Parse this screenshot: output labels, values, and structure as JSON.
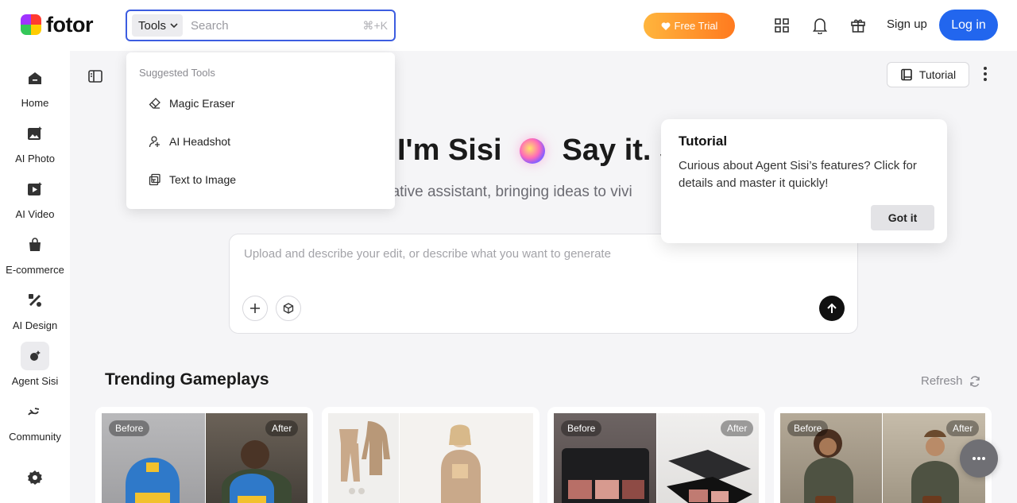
{
  "brand": {
    "name": "fotor"
  },
  "search": {
    "scope_label": "Tools",
    "placeholder": "Search",
    "shortcut": "⌘+K"
  },
  "header": {
    "free_trial": "Free Trial",
    "sign_up": "Sign up",
    "log_in": "Log in"
  },
  "sidebar": {
    "items": [
      {
        "label": "Home",
        "icon": "home-icon"
      },
      {
        "label": "AI Photo",
        "icon": "ai-photo-icon"
      },
      {
        "label": "AI Video",
        "icon": "ai-video-icon"
      },
      {
        "label": "E-commerce",
        "icon": "shopping-bag-icon"
      },
      {
        "label": "AI Design",
        "icon": "ai-design-icon"
      },
      {
        "label": "Agent Sisi",
        "icon": "agent-sisi-icon",
        "active": true
      },
      {
        "label": "Community",
        "icon": "community-icon"
      }
    ]
  },
  "dropdown": {
    "heading": "Suggested Tools",
    "items": [
      {
        "label": "Magic Eraser",
        "icon": "eraser-icon"
      },
      {
        "label": "AI Headshot",
        "icon": "headshot-icon"
      },
      {
        "label": "Text to Image",
        "icon": "text-to-image-icon"
      }
    ]
  },
  "main": {
    "tutorial_label": "Tutorial",
    "hero_left": "I'm Sisi",
    "hero_right": "Say it. S",
    "hero_subtitle": "eative assistant, bringing ideas to vivi",
    "prompt_placeholder": "Upload and describe your edit, or describe what you want to generate",
    "trending_title": "Trending Gameplays",
    "refresh_label": "Refresh"
  },
  "cards": [
    {
      "before": "Before",
      "after": "After"
    },
    {
      "before": "",
      "after": ""
    },
    {
      "before": "Before",
      "after": "After"
    },
    {
      "before": "Before",
      "after": "After"
    }
  ],
  "popover": {
    "title": "Tutorial",
    "body": "Curious about Agent Sisi’s features? Click for details and master it quickly!",
    "button": "Got it"
  },
  "colors": {
    "accent": "#2266ee",
    "search_border": "#3c5de0",
    "trial_start": "#ffb53d",
    "trial_end": "#ff7a1f"
  }
}
